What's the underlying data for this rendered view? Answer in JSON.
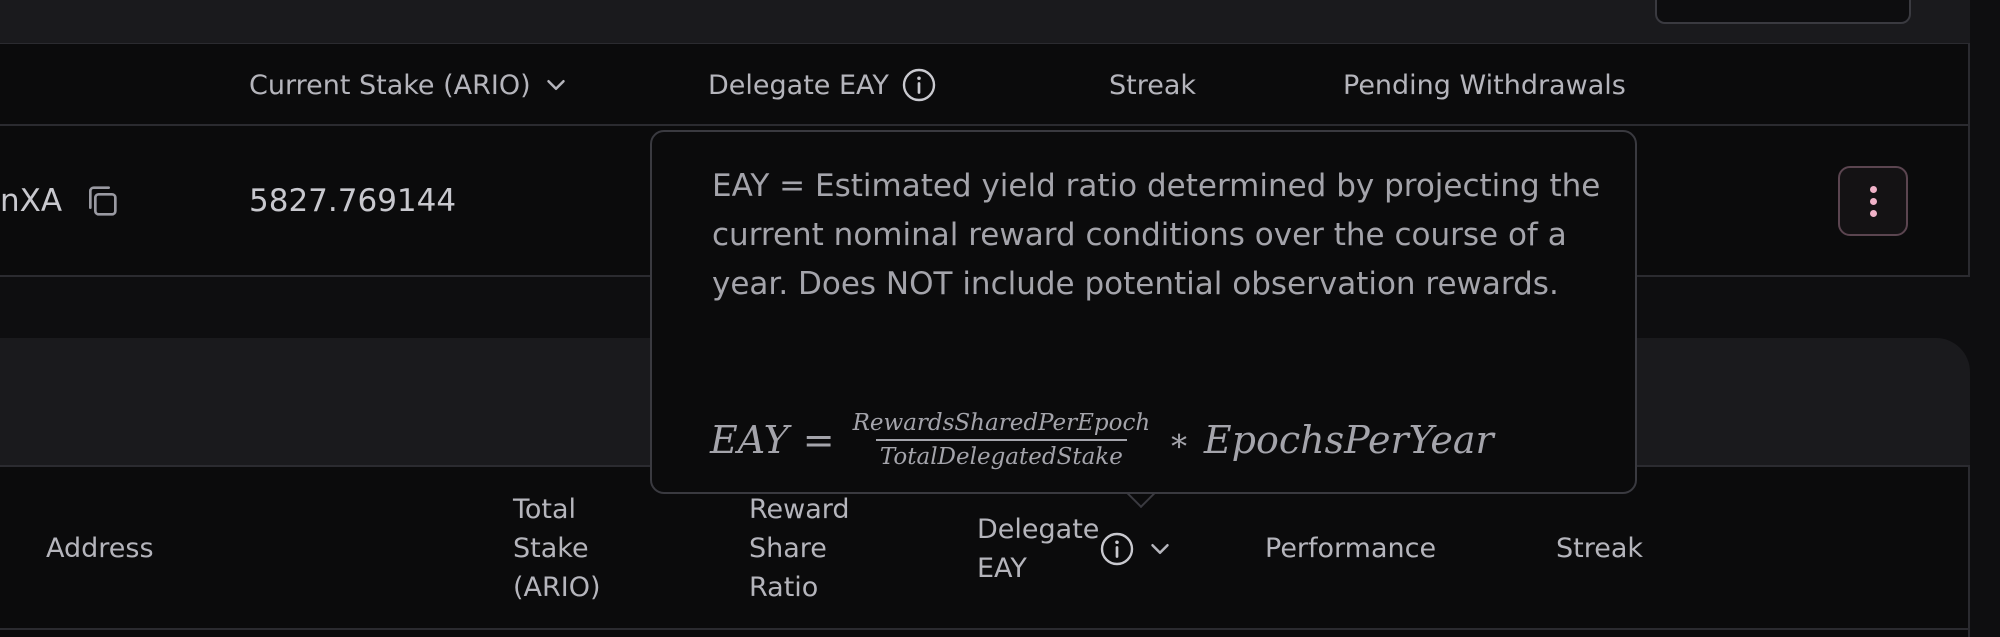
{
  "stake_table": {
    "headers": {
      "current_stake": "Current Stake (ARIO)",
      "delegate_eay": "Delegate EAY",
      "streak": "Streak",
      "pending_withdrawals": "Pending Withdrawals"
    },
    "row": {
      "address_fragment": "nXA",
      "current_stake": "5827.769144"
    }
  },
  "gateway_table": {
    "headers": {
      "address": "Address",
      "total_stake": "Total Stake (ARIO)",
      "reward_share_ratio": "Reward Share Ratio",
      "delegate_eay": "Delegate EAY",
      "performance": "Performance",
      "streak": "Streak"
    }
  },
  "tooltip": {
    "text": "EAY = Estimated yield ratio determined by projecting the current nominal reward conditions over the course of a year. Does NOT include potential observation rewards.",
    "formula": {
      "lhs": "EAY",
      "equals": "=",
      "numerator": "RewardsSharedPerEpoch",
      "denominator": "TotalDelegatedStake",
      "operator": "∗",
      "rhs": "EpochsPerYear"
    }
  },
  "icons": {
    "info": "info-circle-icon",
    "sort": "chevron-down-icon",
    "copy": "copy-icon",
    "menu": "more-vertical-icon"
  },
  "colors": {
    "accent": "#f0b2c8",
    "background": "#0b0b0c",
    "panel": "#1a1a1d",
    "border": "#2b2b30"
  }
}
